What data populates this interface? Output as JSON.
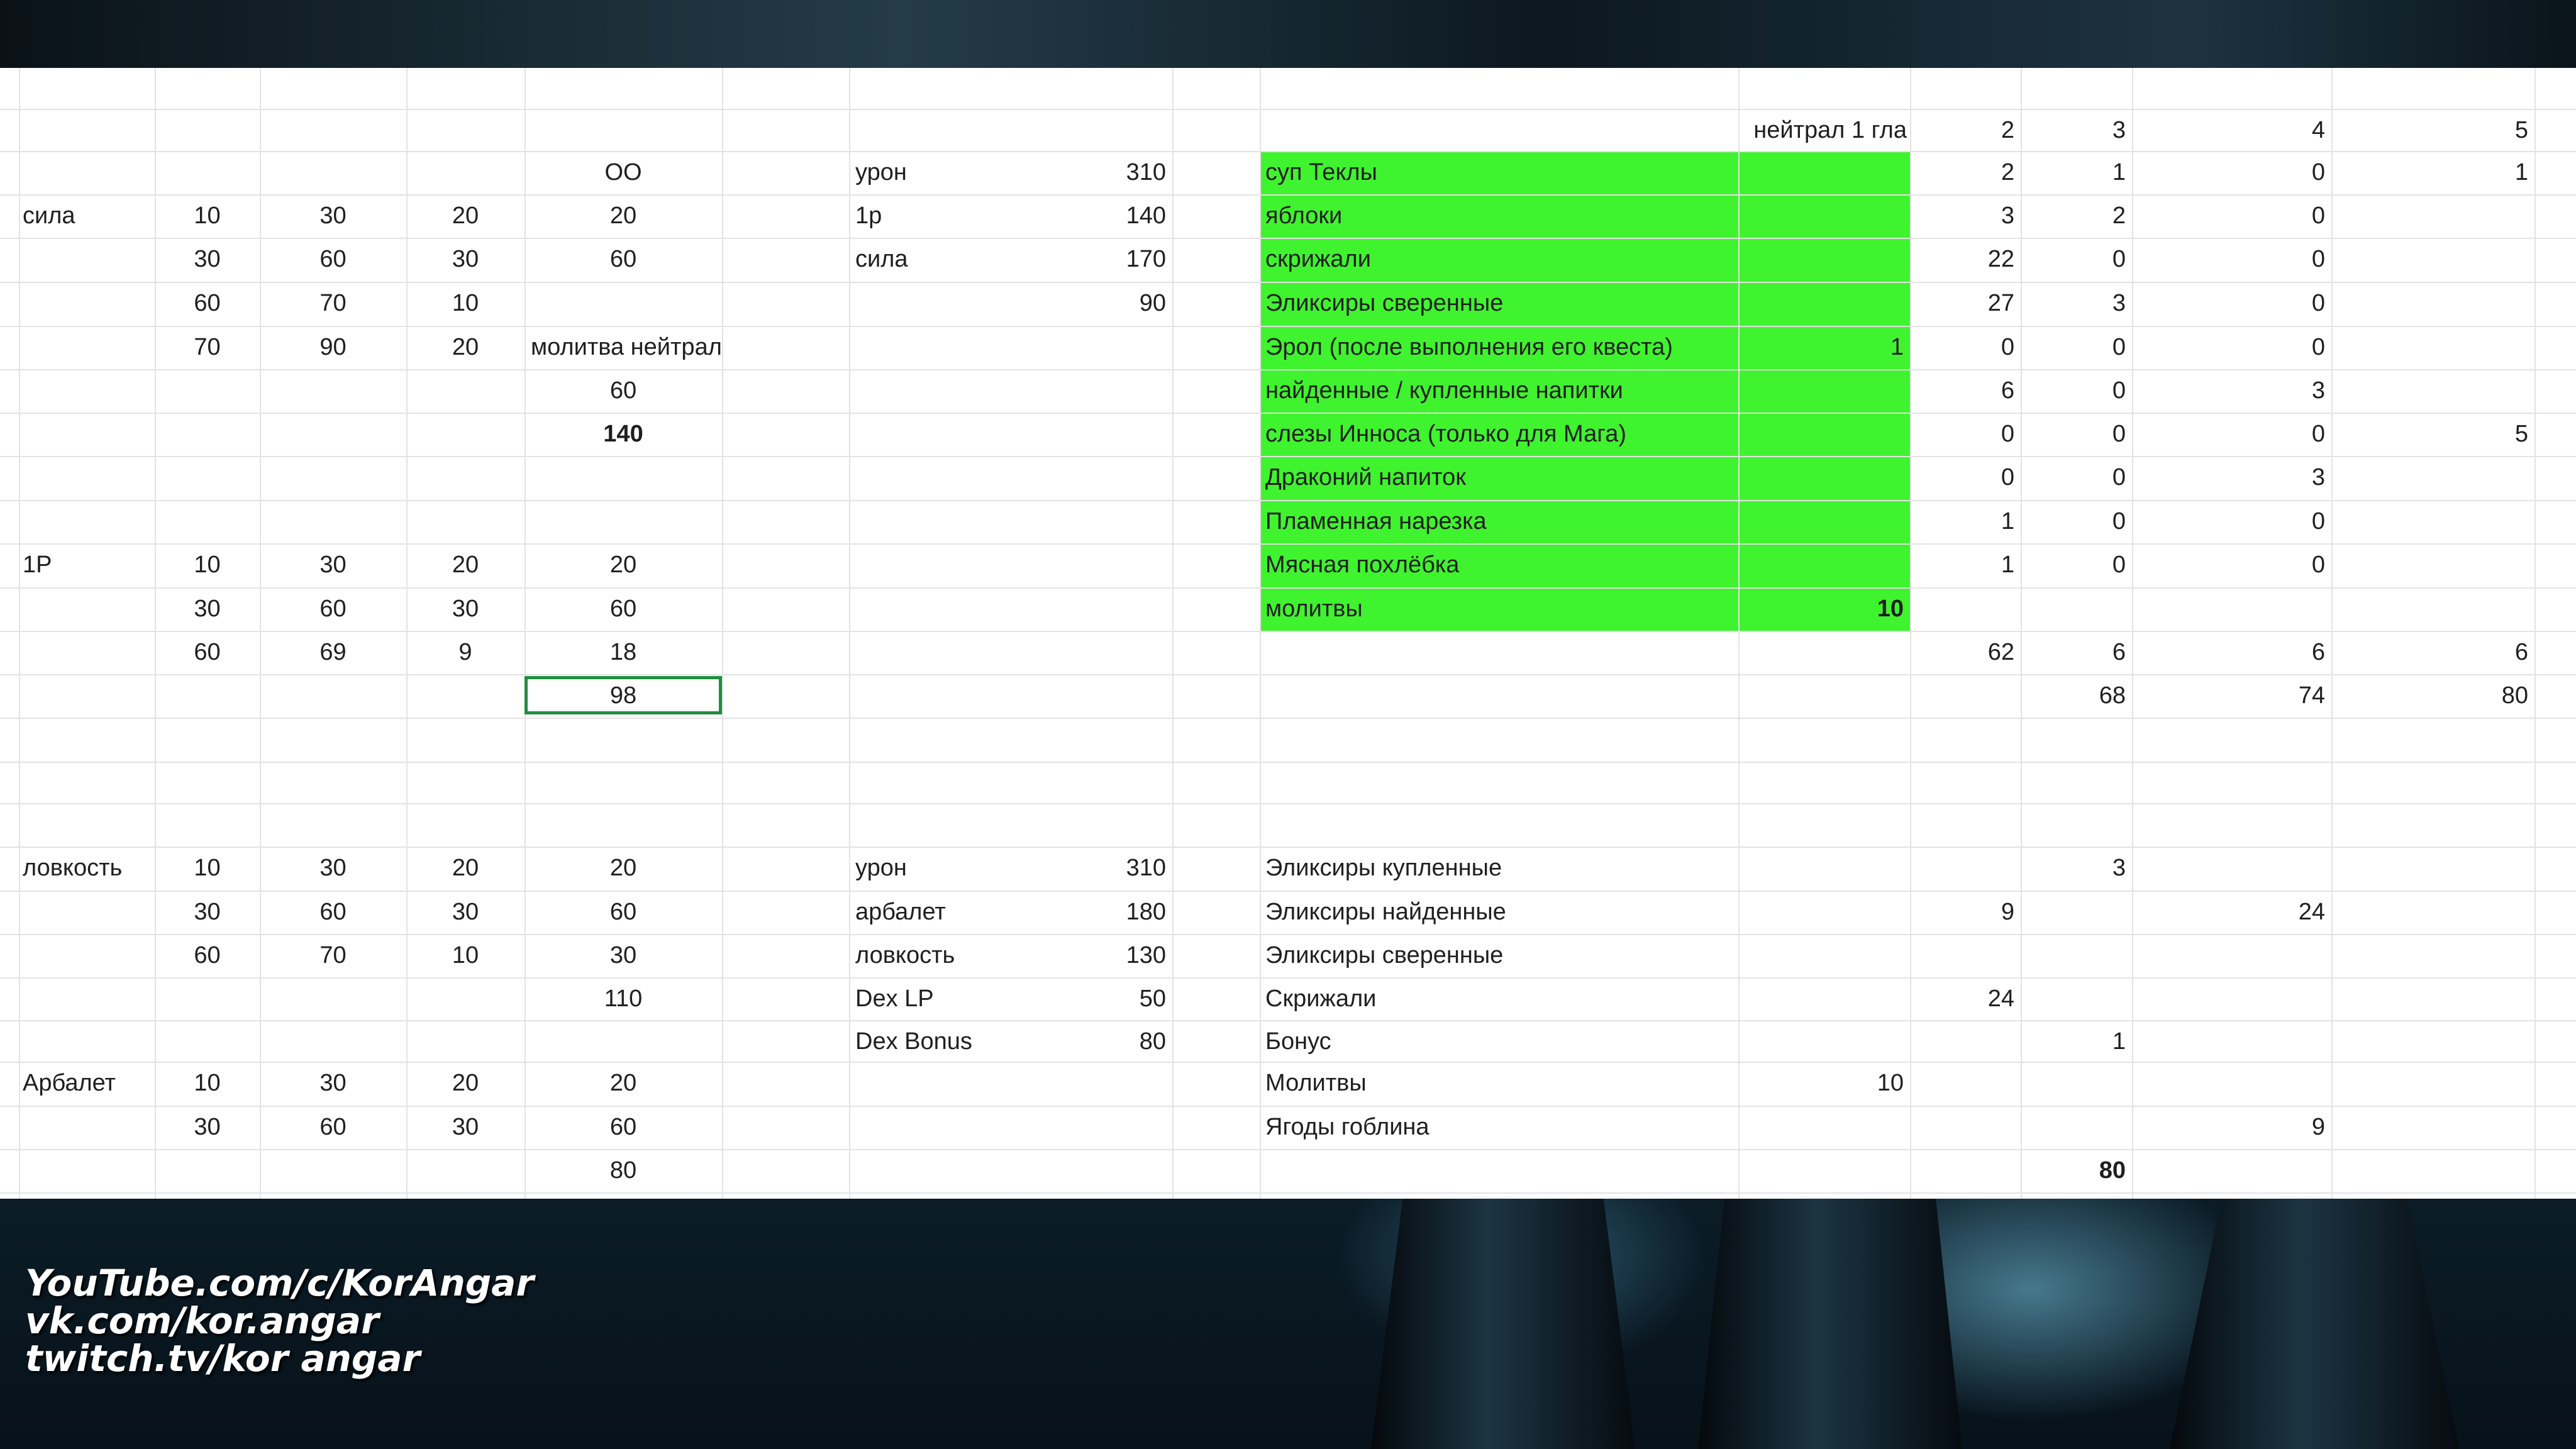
{
  "sheet": {
    "colA": {
      "sila": "сила",
      "1p": "1Р",
      "lovkost": "ловкость",
      "arbalet": "Арбалет"
    },
    "colB": [
      "10",
      "30",
      "60",
      "70",
      "10",
      "30",
      "60",
      "10",
      "30",
      "60",
      "10",
      "30"
    ],
    "colC": [
      "30",
      "60",
      "70",
      "90",
      "30",
      "60",
      "69",
      "30",
      "60",
      "70",
      "30",
      "60"
    ],
    "colD": [
      "20",
      "30",
      "10",
      "20",
      "20",
      "30",
      "9",
      "20",
      "30",
      "10",
      "20",
      "30"
    ],
    "colE": {
      "oo": "ОО",
      "r1": "20",
      "r2": "60",
      "r3": "молитва нейтрал",
      "r4": "60",
      "r5": "140",
      "r10": "20",
      "r11": "60",
      "r12": "18",
      "r13": "98",
      "r17": "20",
      "r18": "60",
      "r19": "30",
      "r20": "110",
      "r22": "20",
      "r23": "60",
      "r24": "80"
    },
    "colG": {
      "r1": "урон",
      "r2": "1р",
      "r3": "сила",
      "r16": "урон",
      "r17": "арбалет",
      "r18": "ловкость",
      "r19": "Dex LP",
      "r20": "Dex Bonus"
    },
    "colH": {
      "r1": "310",
      "r2": "140",
      "r3": "170",
      "r4": "90",
      "r16": "310",
      "r17": "180",
      "r18": "130",
      "r19": "50",
      "r20": "80"
    },
    "colJ": {
      "header": "нейтрал 1 гла",
      "r1": "суп Теклы",
      "r2": "яблоки",
      "r3": "скрижали",
      "r4": "Эликсиры сверенные",
      "r5": "Эрол (после выполнения его квеста)",
      "r6": "найденные / купленные напитки",
      "r7": "слезы Инноса (только для Мага)",
      "r8": "Драконий напиток",
      "r9": "Пламенная нарезка",
      "r10": "Мясная похлёбка",
      "r11": "молитвы",
      "r16": "Эликсиры купленные",
      "r17": "Эликсиры найденные",
      "r18": "Эликсиры сверенные",
      "r19": "Скрижали",
      "r20": "Бонус",
      "r21": "Молитвы",
      "r22": "Ягоды гоблина"
    },
    "colK": {
      "r5": "1",
      "r11": "10",
      "r21": "10"
    },
    "colL": {
      "r0": "2",
      "r1": "2",
      "r2": "3",
      "r3": "22",
      "r4": "27",
      "r5": "0",
      "r6": "6",
      "r7": "0",
      "r8": "0",
      "r9": "1",
      "r10": "1",
      "r12": "62",
      "r17": "9",
      "r19": "24"
    },
    "colM": {
      "r0": "3",
      "r1": "1",
      "r2": "2",
      "r3": "0",
      "r4": "3",
      "r5": "0",
      "r6": "0",
      "r7": "0",
      "r8": "0",
      "r9": "0",
      "r10": "0",
      "r12": "6",
      "r13": "68",
      "r16": "3",
      "r20": "1",
      "r23": "80"
    },
    "colN": {
      "r0": "4",
      "r1": "0",
      "r2": "0",
      "r3": "0",
      "r4": "0",
      "r5": "0",
      "r6": "3",
      "r7": "0",
      "r8": "3",
      "r9": "0",
      "r10": "0",
      "r12": "6",
      "r13": "74",
      "r18": "24",
      "r22": "9"
    },
    "colO": {
      "r0": "5",
      "r1": "1",
      "r7": "5",
      "r12": "6",
      "r13": "80"
    }
  },
  "overlay": {
    "links": [
      "YouTube.com/c/KorAngar",
      "vk.com/kor.angar",
      "twitch.tv/kor angar"
    ]
  },
  "colors": {
    "highlight": "#40f32f",
    "selection": "#1e8e3e"
  }
}
